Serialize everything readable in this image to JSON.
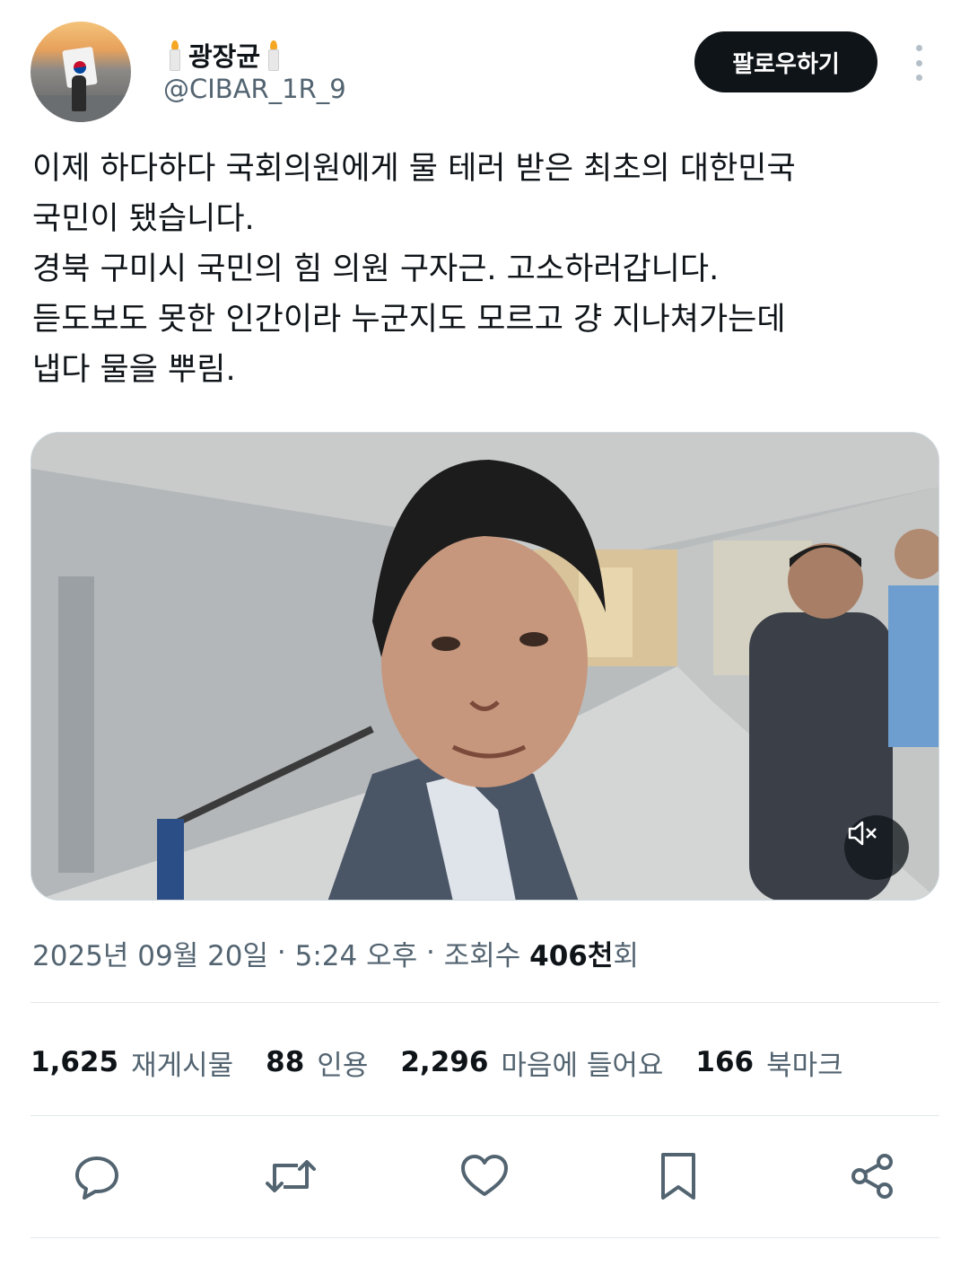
{
  "user": {
    "display_name": "광장균",
    "handle": "@CIBAR_1R_9",
    "name_emoji_icon": "candle-icon"
  },
  "header": {
    "follow_label": "팔로우하기",
    "more_icon": "more-vertical-icon"
  },
  "tweet": {
    "lines": [
      "이제 하다하다 국회의원에게 물 테러 받은 최초의 대한민국",
      "국민이 됐습니다.",
      "경북 구미시 국민의 힘 의원 구자근. 고소하러갑니다.",
      "듣도보도 못한 인간이라 누군지도 모르고 걍 지나쳐가는데",
      "냅다 물을 뿌림."
    ]
  },
  "media": {
    "mute_icon": "speaker-muted-icon"
  },
  "meta": {
    "date": "2025년 09월 20일",
    "sep1": " · ",
    "time": "5:24 오후",
    "sep2": " · ",
    "views_label": "조회수 ",
    "views_count": "406천",
    "views_suffix": "회"
  },
  "stats": [
    {
      "count": "1,625",
      "label": "재게시물"
    },
    {
      "count": "88",
      "label": "인용"
    },
    {
      "count": "2,296",
      "label": "마음에 들어요"
    },
    {
      "count": "166",
      "label": "북마크"
    }
  ],
  "actions": {
    "reply_icon": "reply-icon",
    "repost_icon": "repost-icon",
    "like_icon": "heart-icon",
    "bookmark_icon": "bookmark-icon",
    "share_icon": "share-icon"
  },
  "colors": {
    "text_primary": "#0f1419",
    "text_secondary": "#536471",
    "button_bg": "#0f1419",
    "divider": "#e3e8eb"
  }
}
